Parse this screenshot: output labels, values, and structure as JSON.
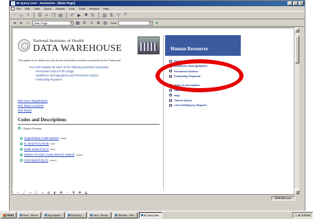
{
  "window": {
    "title": "BI Query User - Humanres - [Main Page]",
    "buttons": [
      "_",
      "□",
      "×"
    ]
  },
  "menu": [
    "File",
    "Edit",
    "View",
    "Query",
    "Results",
    "Host",
    "Tools",
    "Window",
    "Help"
  ],
  "formbar": {
    "page_select": "Main Page",
    "find_label": "Find:",
    "find_value": ""
  },
  "page": {
    "logo": {
      "line1": "National Institutes of Health",
      "line2": "DATA WAREHOUSE"
    },
    "notice": "This system is for official use only and the information provided is protected by the Privacy Act.",
    "register": {
      "intro": "You must register for each of the following activities separately:",
      "items": [
        "- Personnel Cost & FTE Usage",
        "- Workforce Demographics and Personnel Actions",
        "- Fellowship Payment"
      ]
    },
    "left_links": [
      "DW User Registration",
      "DW Data Contents",
      "DW News"
    ],
    "codes": {
      "title": "Codes and Descriptions",
      "report_preview": "= Report Preview",
      "items": [
        {
          "label": "Organization Code Search",
          "tag": "(1052)"
        },
        {
          "label": "IC Search by Node",
          "tag": "(507)"
        },
        {
          "label": "Node Search by IC",
          "tag": "(962)"
        },
        {
          "label": "Nature of Action Code (NOAC) Search",
          "tag": "(44044)"
        },
        {
          "label": "CAN Search by IC",
          "tag": "(95937)"
        }
      ]
    },
    "hr": {
      "title": "Human Resources",
      "items": [
        "Personnel Costs & FTE Usage",
        "Workforce Demographics",
        "Personnel Actions",
        "Fellowship Payment"
      ],
      "items2": [
        "News & Information",
        "Data Dictionary",
        "Help",
        "Cancel Query",
        "List of DWQuery Reports"
      ]
    }
  },
  "statusbar": {
    "zone": "DBRCBM.com"
  },
  "taskbar": {
    "start": "Start",
    "tasks": [
      "Inbox - Micros...",
      "http://appsrv...",
      "DWQuery | ...",
      "Inbox - Micros...",
      "Windows - Micr...",
      "BI Query User..."
    ],
    "clock": "9:55 AM"
  },
  "colors": {
    "highlight_circle": "#e60000",
    "hr_header_bg": "#3a5aa0",
    "link": "#2040c0"
  }
}
